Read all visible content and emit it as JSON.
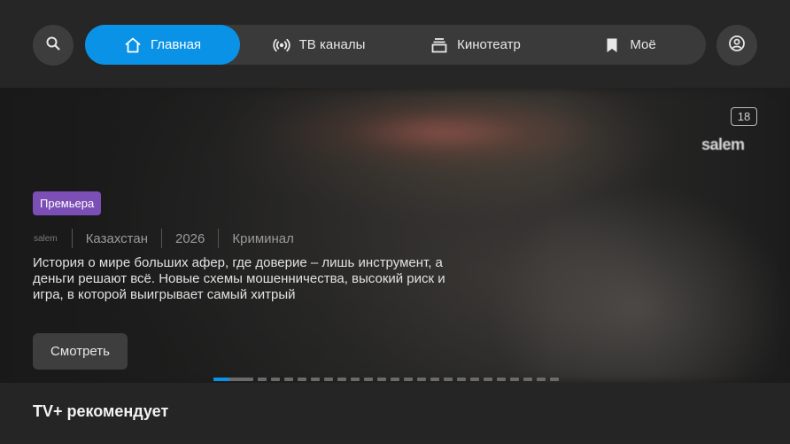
{
  "header": {
    "search_icon": "search-icon",
    "profile_icon": "user-circle-icon",
    "tabs": [
      {
        "label": "Главная",
        "icon": "home-icon",
        "active": true
      },
      {
        "label": "ТВ каналы",
        "icon": "broadcast-icon",
        "active": false
      },
      {
        "label": "Кинотеатр",
        "icon": "film-stack-icon",
        "active": false
      },
      {
        "label": "Моё",
        "icon": "bookmark-icon",
        "active": false
      }
    ]
  },
  "hero": {
    "age_rating": "18",
    "brand_logo": "salem",
    "badge": "Премьера",
    "meta": {
      "logo": "salem",
      "country": "Казахстан",
      "year": "2026",
      "genre": "Криминал"
    },
    "description": "История о мире больших афер, где доверие – лишь инструмент, а деньги решают всё. Новые схемы мошенничества, высокий риск и игра, в которой выигрывает самый хитрый",
    "watch_label": "Смотреть",
    "carousel": {
      "total": 24,
      "current": 1,
      "current_progress": 0.4
    }
  },
  "recommendations": {
    "title": "TV+ рекомендует"
  },
  "colors": {
    "accent": "#0a93e6",
    "badge": "#7b4fb5",
    "background": "#252525"
  }
}
